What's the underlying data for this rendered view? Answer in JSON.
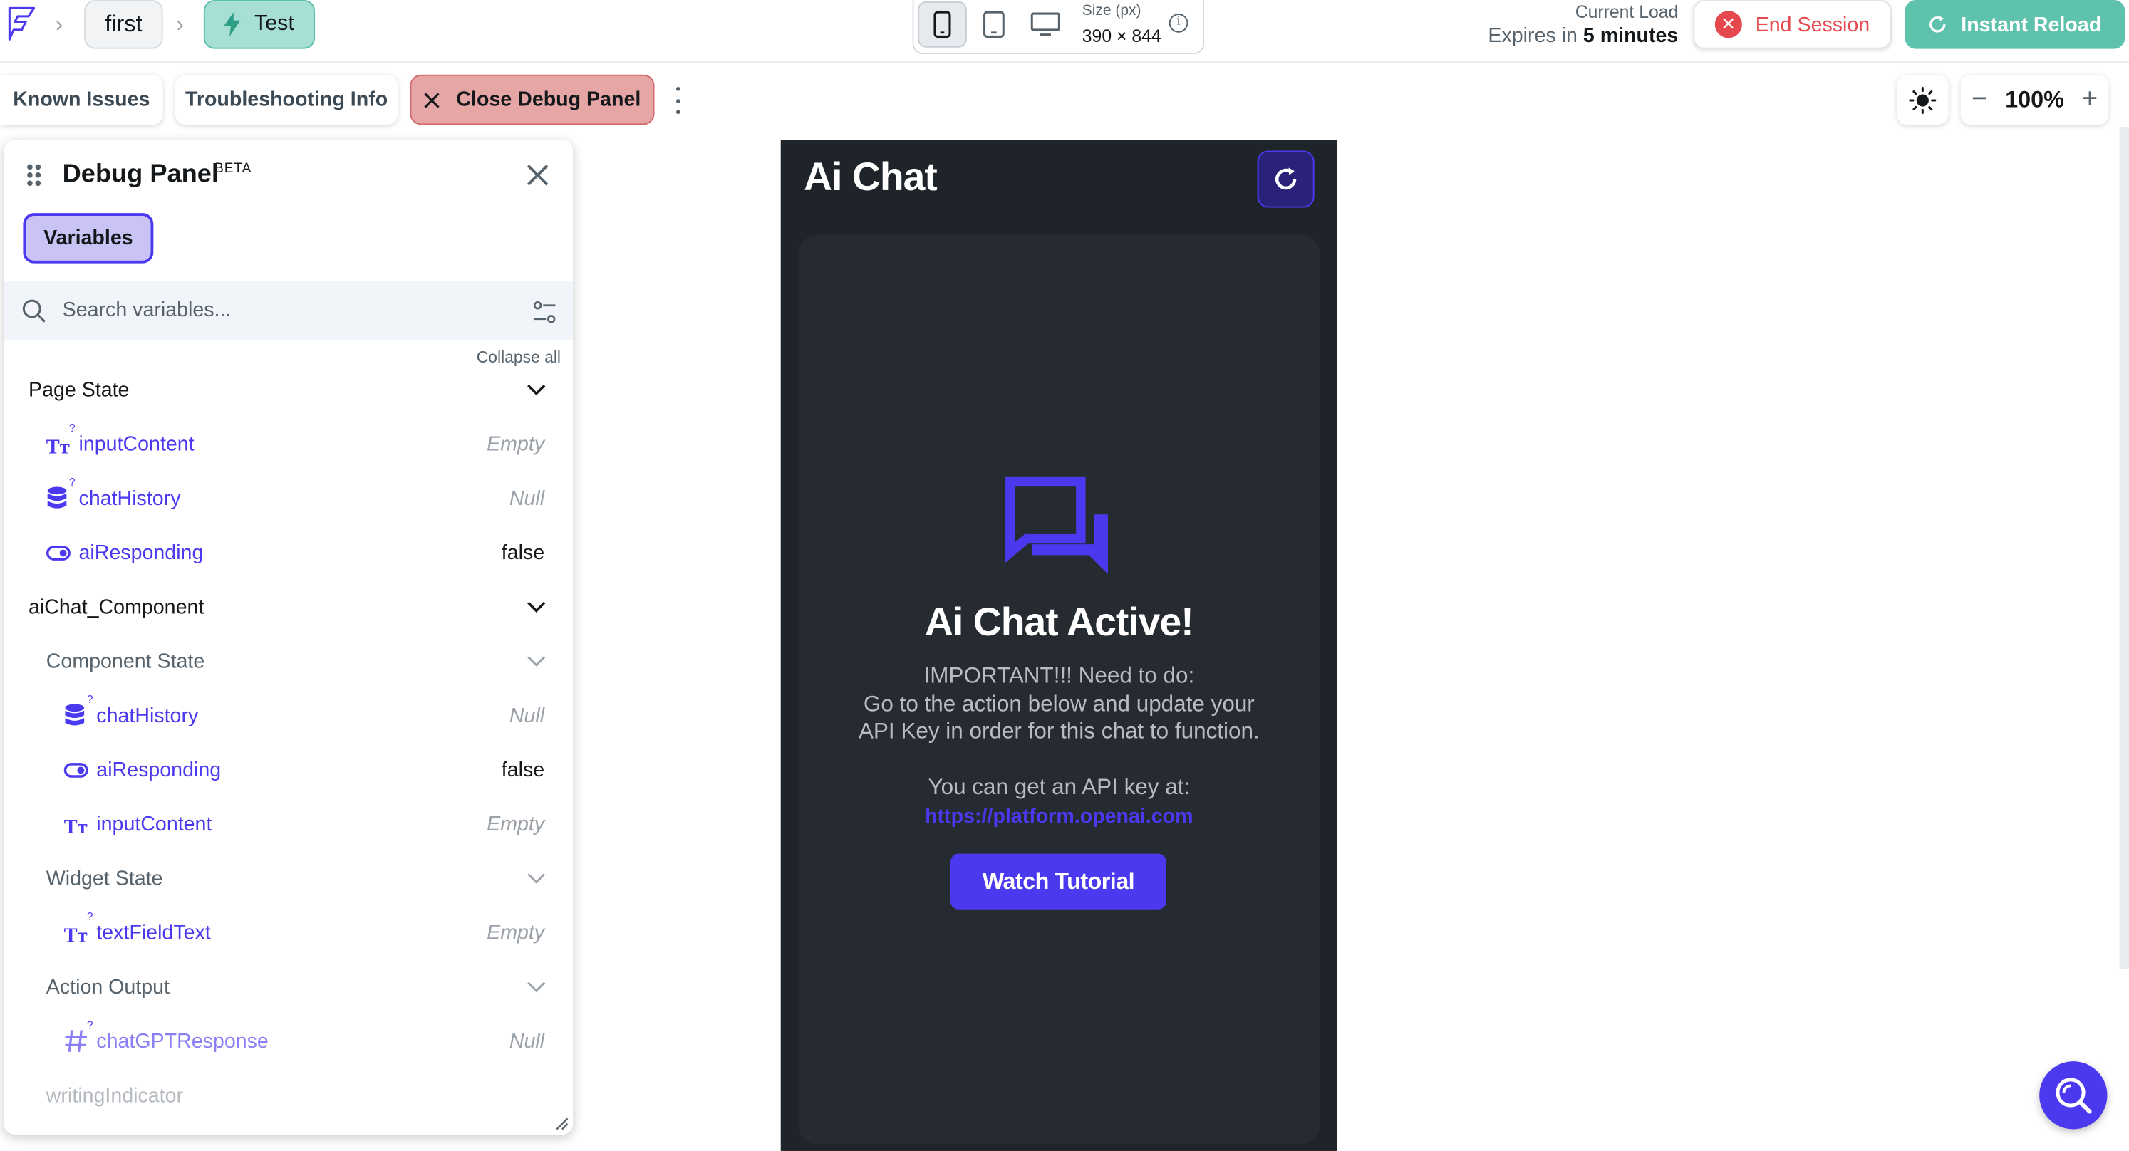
{
  "topbar": {
    "project_chip": "first",
    "mode_chip": "Test",
    "size_label": "Size (px)",
    "size_value": "390 × 844",
    "load_title": "Current Load",
    "expires_prefix": "Expires in",
    "expires_value": "5 minutes",
    "end_session": "End Session",
    "instant_reload": "Instant Reload"
  },
  "toolbar": {
    "known_issues": "Known Issues",
    "troubleshooting": "Troubleshooting Info",
    "close_debug": "Close Debug Panel",
    "zoom": "100%"
  },
  "debug_panel": {
    "title": "Debug Panel",
    "badge": "BETA",
    "tab_variables": "Variables",
    "search_placeholder": "Search variables...",
    "collapse_all": "Collapse all",
    "groups": [
      {
        "label": "Page State",
        "vars": [
          {
            "name": "inputContent",
            "value": "Empty",
            "type_icon": "text-type-icon"
          },
          {
            "name": "chatHistory",
            "value": "Null",
            "type_icon": "database-icon"
          },
          {
            "name": "aiResponding",
            "value": "false",
            "type_icon": "toggle-icon"
          }
        ]
      },
      {
        "label": "aiChat_Component",
        "subgroups": [
          {
            "label": "Component State",
            "vars": [
              {
                "name": "chatHistory",
                "value": "Null",
                "type_icon": "database-icon"
              },
              {
                "name": "aiResponding",
                "value": "false",
                "type_icon": "toggle-icon"
              },
              {
                "name": "inputContent",
                "value": "Empty",
                "type_icon": "text-type-icon"
              }
            ]
          },
          {
            "label": "Widget State",
            "vars": [
              {
                "name": "textFieldText",
                "value": "Empty",
                "type_icon": "text-type-icon"
              }
            ]
          },
          {
            "label": "Action Output",
            "vars": [
              {
                "name": "chatGPTResponse",
                "value": "Null",
                "type_icon": "hash-icon"
              }
            ]
          }
        ]
      }
    ],
    "trailing_item": "writingIndicator"
  },
  "phone": {
    "app_title": "Ai Chat",
    "heading": "Ai Chat Active!",
    "body_lines": [
      "IMPORTANT!!! Need to do:",
      "Go to the action below and update your",
      "API Key in order for this chat to function.",
      "",
      "You can get an API key at:"
    ],
    "link": "https://platform.openai.com",
    "button": "Watch Tutorial"
  },
  "colors": {
    "primary": "#4b39ef",
    "teal": "#5ec2ad",
    "danger": "#e5484d",
    "phone_bg": "#1e2429"
  }
}
